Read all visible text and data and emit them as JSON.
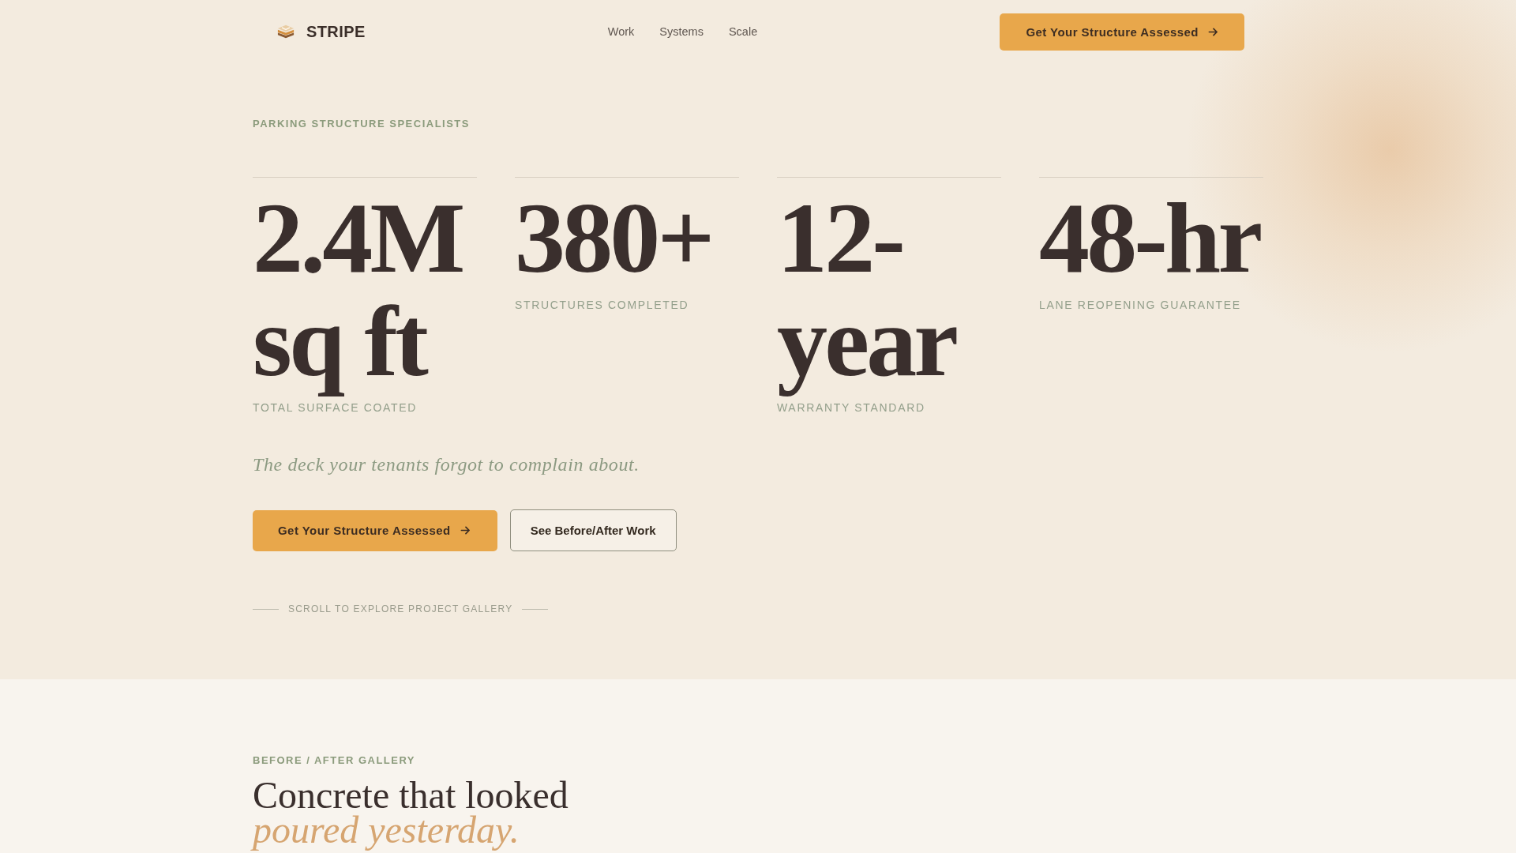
{
  "header": {
    "brand": "STRIPE",
    "nav": [
      "Work",
      "Systems",
      "Scale"
    ],
    "cta": "Get Your Structure Assessed"
  },
  "hero": {
    "eyebrow": "PARKING STRUCTURE SPECIALISTS",
    "stats": [
      {
        "value": "2.4M sq ft",
        "label": "TOTAL SURFACE COATED"
      },
      {
        "value": "380+",
        "label": "STRUCTURES COMPLETED"
      },
      {
        "value": "12-year",
        "label": "WARRANTY STANDARD"
      },
      {
        "value": "48-hr",
        "label": "LANE REOPENING GUARANTEE"
      }
    ],
    "tagline": "The deck your tenants forgot to complain about.",
    "buttons": [
      {
        "label": "Get Your Structure Assessed",
        "kind": "primary"
      },
      {
        "label": "See Before/After Work",
        "kind": "secondary"
      }
    ],
    "scroll_hint": "SCROLL TO EXPLORE PROJECT GALLERY"
  },
  "gallery": {
    "eyebrow": "BEFORE / AFTER GALLERY",
    "heading": "Concrete that looked *poured yesterday.*"
  }
}
